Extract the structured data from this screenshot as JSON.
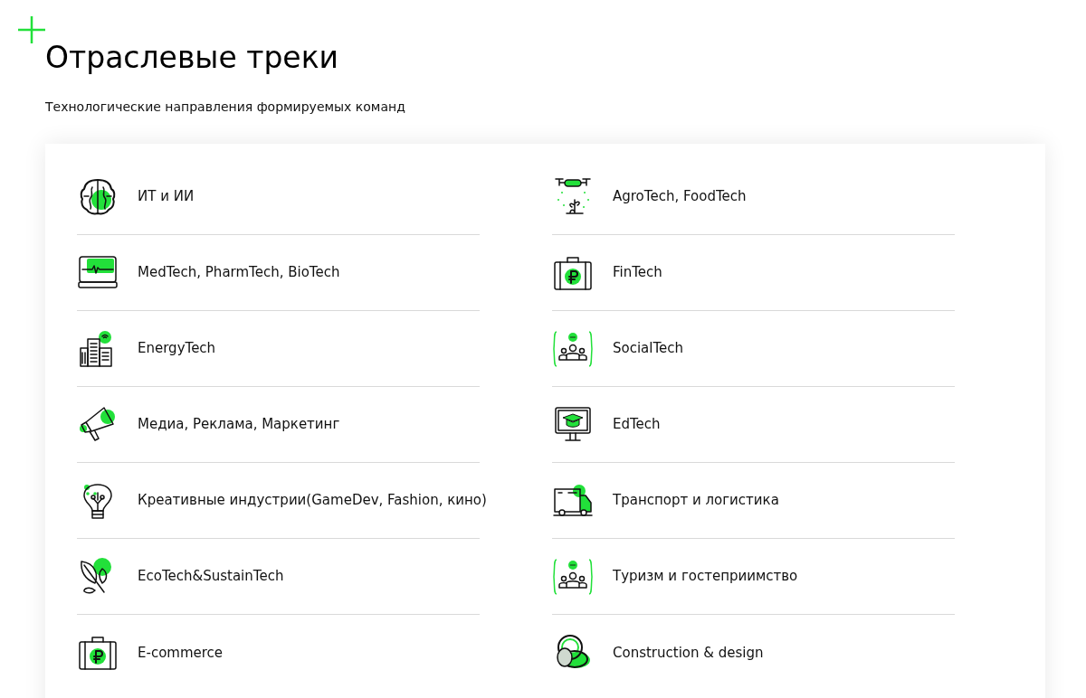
{
  "heading": {
    "title": "Отраслевые треки",
    "subtitle": "Технологические направления формируемых команд"
  },
  "tracks": {
    "left_column": [
      {
        "label": "ИТ и ИИ",
        "kind": "brain"
      },
      {
        "label": "MedTech, PharmTech, BioTech",
        "kind": "monitor"
      },
      {
        "label": "EnergyTech",
        "kind": "buildings"
      },
      {
        "label": "Медиа, Реклама, Маркетинг",
        "kind": "megaphone"
      },
      {
        "label": "Креативные индустрии(GameDev, Fashion, кино)",
        "kind": "bulb"
      },
      {
        "label": "EcoTech&SustainTech",
        "kind": "leaf"
      },
      {
        "label": "E-commerce",
        "kind": "case"
      }
    ],
    "right_column": [
      {
        "label": "AgroTech, FoodTech",
        "kind": "drone"
      },
      {
        "label": "FinTech",
        "kind": "case"
      },
      {
        "label": "SocialTech",
        "kind": "people"
      },
      {
        "label": "EdTech",
        "kind": "screen"
      },
      {
        "label": "Транспорт и логистика",
        "kind": "truck"
      },
      {
        "label": "Туризм и гостеприимство",
        "kind": "people"
      },
      {
        "label": "Construction & design",
        "kind": "rings"
      }
    ]
  }
}
